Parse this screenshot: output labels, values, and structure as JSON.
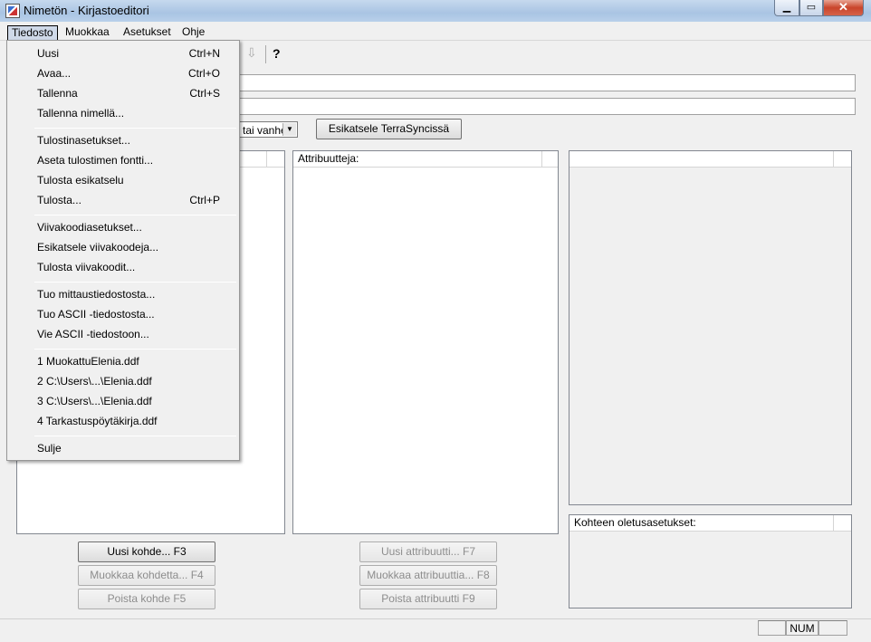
{
  "window": {
    "title": "Nimetön - Kirjastoeditori",
    "min": "▁",
    "max": "▭",
    "close": "✕"
  },
  "menubar": [
    "Tiedosto",
    "Muokkaa",
    "Asetukset",
    "Ohje"
  ],
  "file_menu": {
    "groups": [
      [
        {
          "label": "Uusi",
          "shortcut": "Ctrl+N"
        },
        {
          "label": "Avaa...",
          "shortcut": "Ctrl+O"
        },
        {
          "label": "Tallenna",
          "shortcut": "Ctrl+S"
        },
        {
          "label": "Tallenna nimellä...",
          "shortcut": ""
        }
      ],
      [
        {
          "label": "Tulostinasetukset...",
          "shortcut": ""
        },
        {
          "label": "Aseta tulostimen fontti...",
          "shortcut": ""
        },
        {
          "label": "Tulosta esikatselu",
          "shortcut": ""
        },
        {
          "label": "Tulosta...",
          "shortcut": "Ctrl+P"
        }
      ],
      [
        {
          "label": "Viivakoodiasetukset...",
          "shortcut": ""
        },
        {
          "label": "Esikatsele viivakoodeja...",
          "shortcut": ""
        },
        {
          "label": "Tulosta viivakoodit...",
          "shortcut": ""
        }
      ],
      [
        {
          "label": "Tuo mittaustiedostosta...",
          "shortcut": ""
        },
        {
          "label": "Tuo ASCII -tiedostosta...",
          "shortcut": ""
        },
        {
          "label": "Vie ASCII -tiedostoon...",
          "shortcut": ""
        }
      ],
      [
        {
          "label": "1 MuokattuElenia.ddf",
          "shortcut": ""
        },
        {
          "label": "2 C:\\Users\\...\\Elenia.ddf",
          "shortcut": ""
        },
        {
          "label": "3 C:\\Users\\...\\Elenia.ddf",
          "shortcut": ""
        },
        {
          "label": "4 Tarkastuspöytäkirja.ddf",
          "shortcut": ""
        }
      ],
      [
        {
          "label": "Sulje",
          "shortcut": ""
        }
      ]
    ]
  },
  "toolbar": {
    "down_icon": "⇩",
    "help_icon": "?"
  },
  "combo": {
    "value": "tai vanhe",
    "arrow": "▼"
  },
  "preview_button": "Esikatsele TerraSyncissä",
  "panels": {
    "attributes_header": "Attribuutteja:",
    "defaults_header": "Kohteen oletusasetukset:"
  },
  "buttons": {
    "new_feature": "Uusi kohde... F3",
    "edit_feature": "Muokkaa kohdetta... F4",
    "delete_feature": "Poista kohde F5",
    "new_attribute": "Uusi attribuutti... F7",
    "edit_attribute": "Muokkaa attribuuttia... F8",
    "delete_attribute": "Poista attribuutti F9"
  },
  "status": {
    "num": "NUM"
  }
}
